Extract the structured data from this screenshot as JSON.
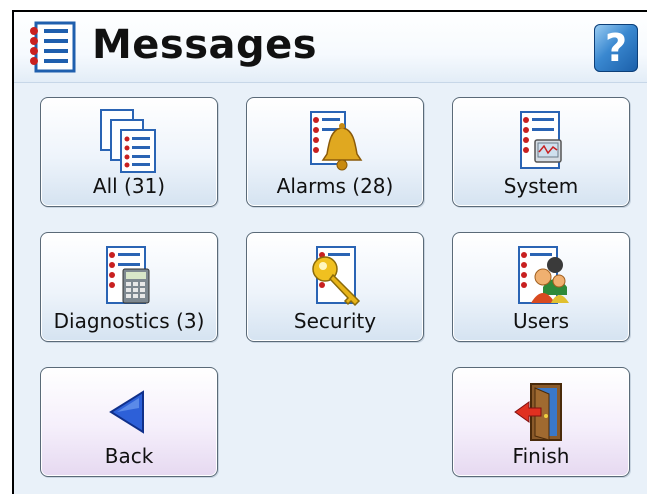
{
  "window": {
    "title": "Messages",
    "help_label": "?"
  },
  "tiles": [
    {
      "label": "All (31)",
      "icon": "all-messages-icon"
    },
    {
      "label": "Alarms (28)",
      "icon": "alarm-bell-icon"
    },
    {
      "label": "System",
      "icon": "system-icon"
    },
    {
      "label": "Diagnostics (3)",
      "icon": "diagnostics-calculator-icon"
    },
    {
      "label": "Security",
      "icon": "security-key-icon"
    },
    {
      "label": "Users",
      "icon": "users-icon"
    }
  ],
  "nav": {
    "back_label": "Back",
    "finish_label": "Finish"
  },
  "colors": {
    "accent": "#2f7bc8",
    "back_arrow": "#1f4fc4",
    "tile_border": "#5a6a78"
  }
}
